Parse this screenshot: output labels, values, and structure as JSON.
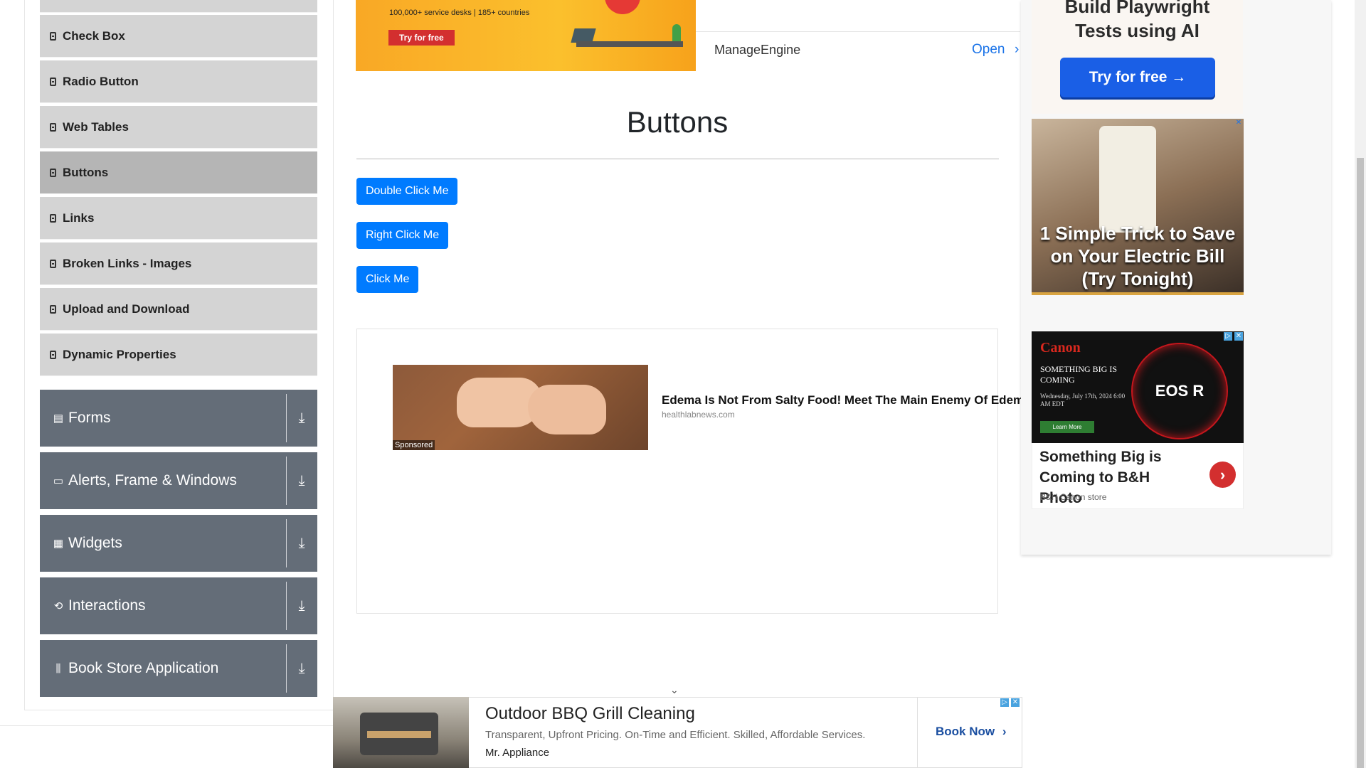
{
  "sidebar": {
    "items": [
      {
        "label": ""
      },
      {
        "label": "Check Box"
      },
      {
        "label": "Radio Button"
      },
      {
        "label": "Web Tables"
      },
      {
        "label": "Buttons"
      },
      {
        "label": "Links"
      },
      {
        "label": "Broken Links - Images"
      },
      {
        "label": "Upload and Download"
      },
      {
        "label": "Dynamic Properties"
      }
    ],
    "active": "Buttons",
    "groups": [
      {
        "label": "Forms",
        "icon": "form-icon"
      },
      {
        "label": "Alerts, Frame & Windows",
        "icon": "window-icon"
      },
      {
        "label": "Widgets",
        "icon": "widgets-icon"
      },
      {
        "label": "Interactions",
        "icon": "interaction-icon"
      },
      {
        "label": "Book Store Application",
        "icon": "book-icon"
      }
    ]
  },
  "top_ad": {
    "tagline": "100,000+ service desks | 185+ countries",
    "cta": "Try for free",
    "company": "ManageEngine",
    "open": "Open",
    "chevron": "›"
  },
  "main": {
    "title": "Buttons",
    "buttons": {
      "double_click": "Double Click Me",
      "right_click": "Right Click Me",
      "click": "Click Me"
    }
  },
  "feed_ad": {
    "sponsored": "Sponsored",
    "title": "Edema Is Not From Salty Food! Meet The Main Enemy Of Edema",
    "source": "healthlabnews.com"
  },
  "bottom_ad": {
    "title": "Outdoor BBQ Grill Cleaning",
    "description": "Transparent, Upfront Pricing. On-Time and Efficient. Skilled, Affordable Services.",
    "brand": "Mr. Appliance",
    "cta": "Book Now",
    "cta_chevron": "›"
  },
  "right_ads": {
    "playwright": {
      "line1": "Build Playwright",
      "line2": "Tests using AI",
      "cta": "Try for free →"
    },
    "outlet": {
      "headline": "1 Simple Trick to Save on Your Electric Bill (Try Tonight)"
    },
    "canon": {
      "logo": "Canon",
      "teaser": "SOMETHING BIG IS COMING",
      "date": "Wednesday, July 17th, 2024 6:00 AM EDT",
      "learn_more": "Learn More",
      "product": "EOS R",
      "headline": "Something Big is Coming to B&H Photo",
      "store": "B&H Canon store",
      "arrow": "›"
    }
  },
  "colors": {
    "primary_button": "#007bff",
    "group_bg": "#646d78",
    "menu_bg": "#d4d4d4",
    "menu_active_bg": "#b5b5b5"
  }
}
